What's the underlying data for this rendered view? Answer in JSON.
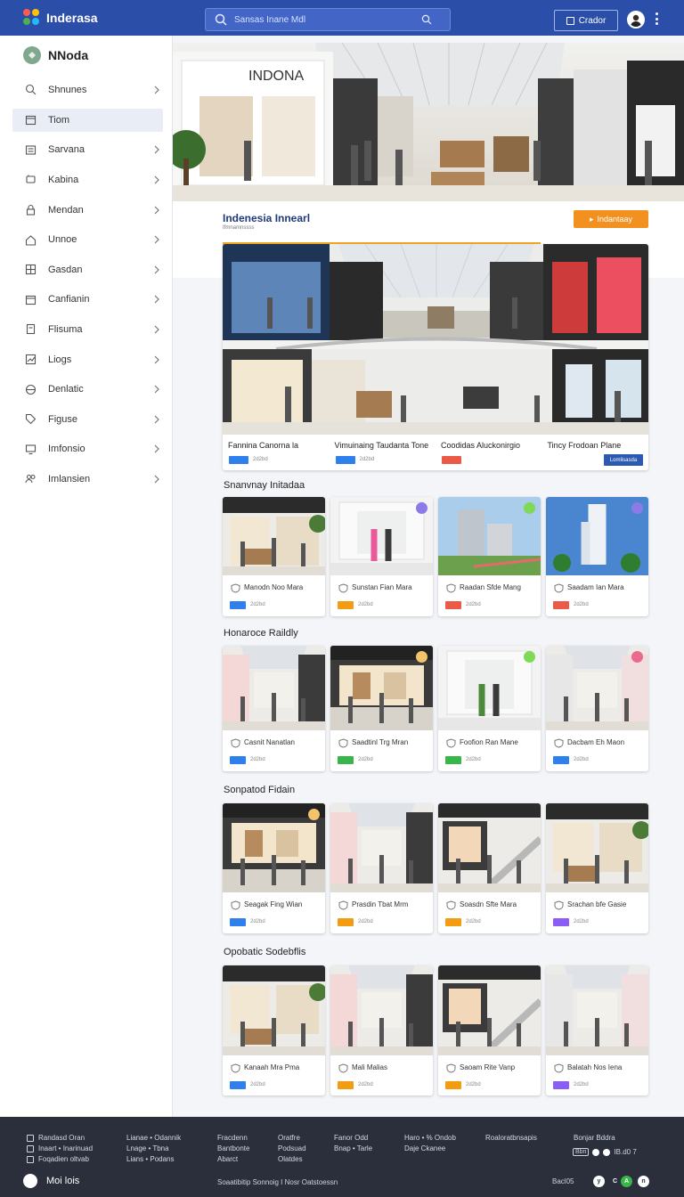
{
  "app": {
    "brand": "Inderasa",
    "sidebar_title": "NNoda"
  },
  "search": {
    "placeholder": "Sansas Inane Mdl"
  },
  "top": {
    "button_label": "Crador"
  },
  "sidebar": {
    "items": [
      {
        "label": "Shnunes",
        "icon": "search-icon"
      },
      {
        "label": "Tiom",
        "icon": "calendar-icon",
        "active": true
      },
      {
        "label": "Sarvana",
        "icon": "list-icon"
      },
      {
        "label": "Kabina",
        "icon": "cart-icon"
      },
      {
        "label": "Mendan",
        "icon": "lock-icon"
      },
      {
        "label": "Unnoe",
        "icon": "home-icon"
      },
      {
        "label": "Gasdan",
        "icon": "grid-icon"
      },
      {
        "label": "Canfianin",
        "icon": "calendar-icon"
      },
      {
        "label": "Flisuma",
        "icon": "document-icon"
      },
      {
        "label": "Liogs",
        "icon": "chart-icon"
      },
      {
        "label": "Denlatic",
        "icon": "globe-icon"
      },
      {
        "label": "Figuse",
        "icon": "tag-icon"
      },
      {
        "label": "Imfonsio",
        "icon": "monitor-icon"
      },
      {
        "label": "Imlansien",
        "icon": "users-icon"
      }
    ]
  },
  "info": {
    "title": "Indenesia Innearl",
    "subtitle": "Ifmnamnssss",
    "button_label": "Indantaay"
  },
  "featured": {
    "columns": [
      {
        "title": "Fannina Canorna la",
        "tag_color": "#2f80ed",
        "tag_text": "2d2bd"
      },
      {
        "title": "Vimuinaing Taudanta Tone",
        "tag_color": "#2f80ed",
        "tag_text": "2d2bd"
      },
      {
        "title": "Coodidas Aluckonirgio",
        "tag_color": "#eb5a46",
        "tag_text": ""
      },
      {
        "title": "Tincy Frodoan Plane",
        "tag_color": "",
        "tag_text": "",
        "button_label": "Lomlisasda"
      }
    ]
  },
  "sections": [
    {
      "title": "Snanvnay Initadaa",
      "cards": [
        {
          "title": "Manodn Noo Mara",
          "tag_color": "#2f80ed",
          "tag_text": "2d2bd",
          "scene": "store"
        },
        {
          "title": "Sunstan Fian Mara",
          "tag_color": "#f39c12",
          "tag_text": "2d2bd",
          "scene": "studio",
          "badge": "#8b7be8"
        },
        {
          "title": "Raadan Sfde Mang",
          "tag_color": "#eb5a46",
          "tag_text": "2d2bd",
          "scene": "building",
          "badge": "#7ed957"
        },
        {
          "title": "Saadam Ian Mara",
          "tag_color": "#eb5a46",
          "tag_text": "2d2bd",
          "scene": "tower",
          "badge": "#8b7be8"
        }
      ]
    },
    {
      "title": "Honaroce Raildly",
      "cards": [
        {
          "title": "Casnit Nanatlan",
          "tag_color": "#2f80ed",
          "tag_text": "2d2bd",
          "scene": "mall"
        },
        {
          "title": "Saadtinl Trg Mran",
          "tag_color": "#39b54a",
          "tag_text": "2d2bd",
          "scene": "store-dark",
          "badge": "#f2c36b"
        },
        {
          "title": "Foofion Ran Mane",
          "tag_color": "#39b54a",
          "tag_text": "2d2bd",
          "scene": "studio2",
          "badge": "#7ed957"
        },
        {
          "title": "Dacbam Eh Maon",
          "tag_color": "#2f80ed",
          "tag_text": "2d2bd",
          "scene": "mall2",
          "badge": "#e96a8d"
        }
      ]
    },
    {
      "title": "Sonpatod Fidain",
      "cards": [
        {
          "title": "Seagak Fing Wian",
          "tag_color": "#2f80ed",
          "tag_text": "2d2bd",
          "scene": "store-dark",
          "badge": "#f2c36b"
        },
        {
          "title": "Prasdin Tbat Mrm",
          "tag_color": "#f39c12",
          "tag_text": "2d2bd",
          "scene": "mall"
        },
        {
          "title": "Soasdn Sfte Mara",
          "tag_color": "#f39c12",
          "tag_text": "2d2bd",
          "scene": "mall-esc"
        },
        {
          "title": "Srachan bfe Gasie",
          "tag_color": "#8b5cf6",
          "tag_text": "2d2bd",
          "scene": "store"
        }
      ]
    },
    {
      "title": "Opobatic Sodebflis",
      "cards": [
        {
          "title": "Kanaah Mra Pma",
          "tag_color": "#2f80ed",
          "tag_text": "2d2bd",
          "scene": "store"
        },
        {
          "title": "Mali Malias",
          "tag_color": "#f39c12",
          "tag_text": "2d2bd",
          "scene": "mall"
        },
        {
          "title": "Saoam Rite Vanp",
          "tag_color": "#f39c12",
          "tag_text": "2d2bd",
          "scene": "mall-esc"
        },
        {
          "title": "Balatah Nos Iena",
          "tag_color": "#8b5cf6",
          "tag_text": "2d2bd",
          "scene": "mall2"
        }
      ]
    }
  ],
  "footer": {
    "col1": [
      "Randasd Oran",
      "Inaart • Inarinuad",
      "Foqadien oltvab"
    ],
    "col2": [
      "Lianae • Odannik",
      "Lnage • Tbna",
      "Lians • Podans"
    ],
    "col3": [
      "Fracdenn",
      "Bantbonte",
      "Abarct"
    ],
    "col4": [
      "Oratfre",
      "Podsuad",
      "Olatdes"
    ],
    "col5": [
      "Fanor Odd",
      "Bnap • Tarle"
    ],
    "col6": [
      "Haro • % Ondob",
      "Daje Ckanee"
    ],
    "col7": [
      "Roaloratbnsapis"
    ],
    "col8": [
      "Bonjar Bddra"
    ],
    "brand": "Moi lois",
    "center": "Soaatibitip Sonnoig I Nosr Oatstoessn",
    "right_code": "Bacl05",
    "meta_pill": "Bbri",
    "meta_code": "IB.d0 7"
  }
}
